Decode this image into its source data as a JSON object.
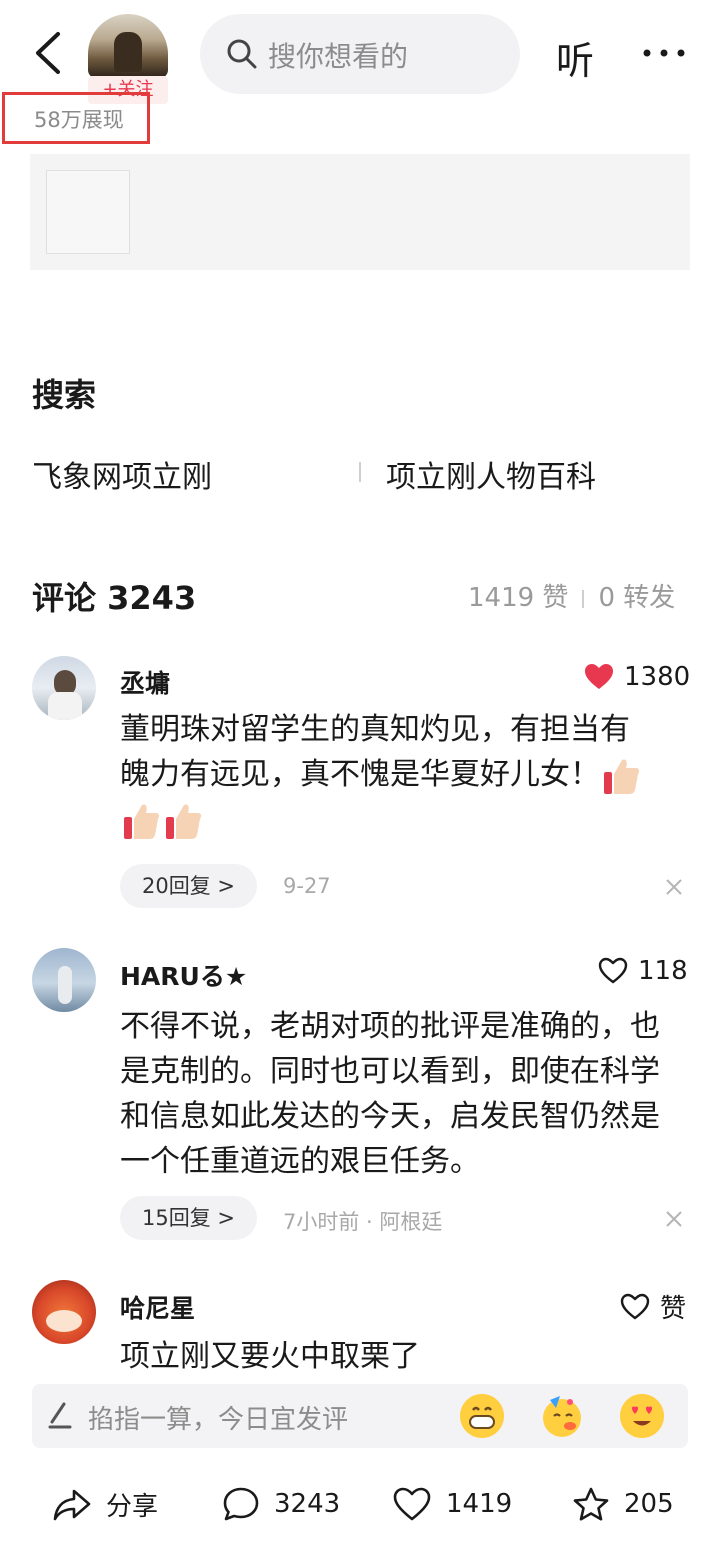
{
  "header": {
    "follow_label": "+关注",
    "views_label": "58万展现",
    "search_placeholder": "搜你想看的",
    "listen_label": "听"
  },
  "search_section": {
    "title": "搜索",
    "links": [
      "飞象网项立刚",
      "项立刚人物百科"
    ]
  },
  "comments": {
    "title": "评论 3243",
    "likes_summary": "1419 赞",
    "shares_summary": "0 转发",
    "items": [
      {
        "name": "丞墉",
        "likes": "1380",
        "liked": true,
        "text_line1": "董明珠对留学生的真知灼见，有担当有",
        "text_line2": "魄力有远见，真不愧是华夏好儿女！",
        "reply_label": "20回复 >",
        "meta": "9-27"
      },
      {
        "name": "HARUる★",
        "likes": "118",
        "liked": false,
        "text": "不得不说，老胡对项的批评是准确的，也是克制的。同时也可以看到，即使在科学和信息如此发达的今天，启发民智仍然是一个任重道远的艰巨任务。",
        "reply_label": "15回复 >",
        "meta": "7小时前 · 阿根廷"
      },
      {
        "name": "哈尼星",
        "likes": "赞",
        "liked": false,
        "text": "项立刚又要火中取栗了"
      }
    ]
  },
  "input_bar": {
    "placeholder": "掐指一算，今日宜发评"
  },
  "bottom_bar": {
    "share_label": "分享",
    "comment_count": "3243",
    "like_count": "1419",
    "favorite_count": "205"
  },
  "colors": {
    "accent_red": "#e8384f",
    "highlight_border": "#e23b3b",
    "muted_text": "#9a9a9a"
  }
}
